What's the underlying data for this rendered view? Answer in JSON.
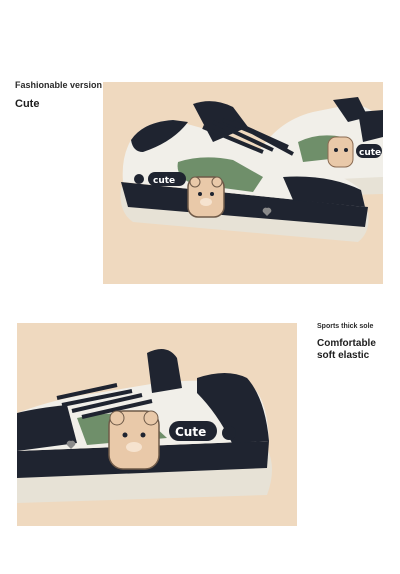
{
  "top_section": {
    "caption_small": "Fashionable version",
    "caption_large": "Cute",
    "shoe_print_text": "cute"
  },
  "bottom_section": {
    "caption_small": "Sports thick sole",
    "caption_large_line1": "Comfortable",
    "caption_large_line2": "soft elastic",
    "shoe_print_text": "Cute"
  },
  "colors": {
    "panel_background": "#efd9bf",
    "shoe_black": "#1f2430",
    "shoe_green": "#6f8f6a",
    "shoe_white": "#f1efe9",
    "sole_cream": "#e7e2d6"
  }
}
